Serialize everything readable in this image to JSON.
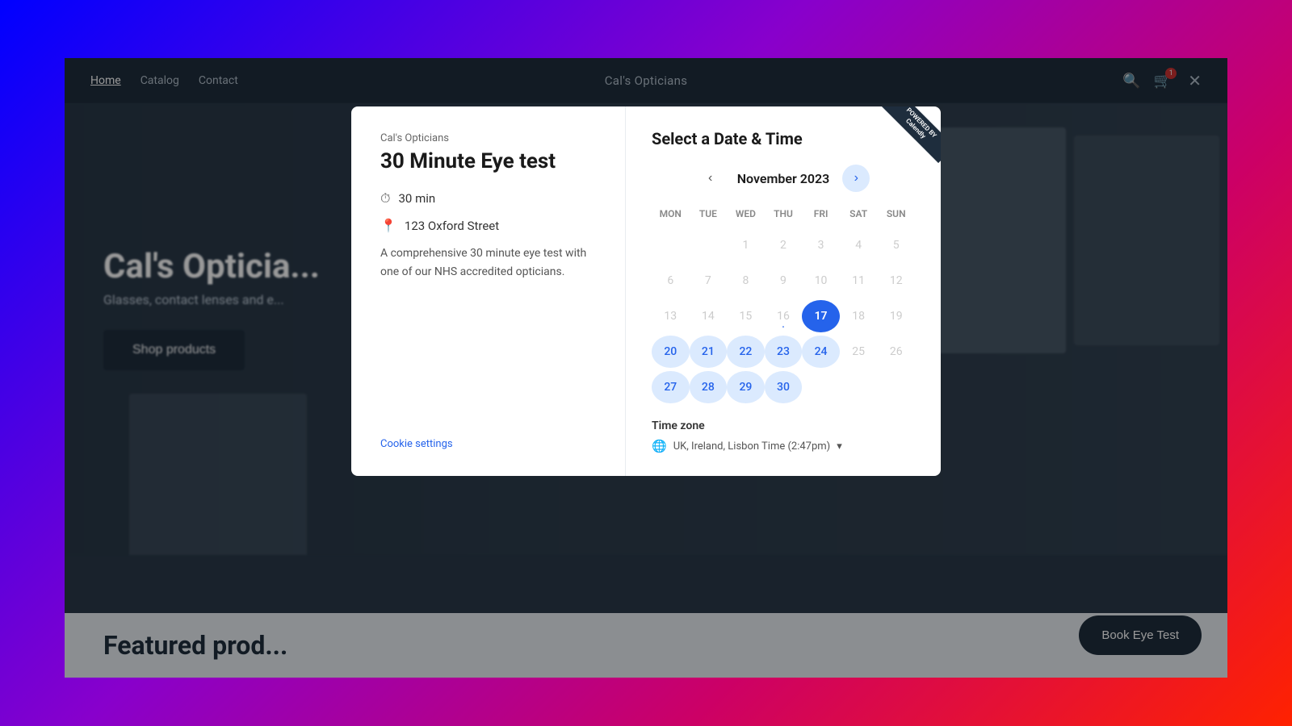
{
  "background": {
    "gradient": "linear-gradient"
  },
  "navbar": {
    "links": [
      {
        "label": "Home",
        "active": true
      },
      {
        "label": "Catalog",
        "active": false
      },
      {
        "label": "Contact",
        "active": false
      }
    ],
    "site_title": "Cal's Opticians",
    "search_icon": "🔍",
    "cart_icon": "🛒",
    "cart_count": "1",
    "close_icon": "✕"
  },
  "hero": {
    "title": "Cal's Opticia...",
    "subtitle": "Glasses, contact lenses and e...",
    "shop_button": "Shop products",
    "featured_label": "Featured prod..."
  },
  "book_button": {
    "label": "Book Eye Test"
  },
  "modal": {
    "left": {
      "company": "Cal's Opticians",
      "service_title": "30 Minute Eye test",
      "duration": "30 min",
      "location": "123 Oxford Street",
      "description": "A comprehensive 30 minute eye test with one of our NHS accredited opticians.",
      "cookie_settings": "Cookie settings"
    },
    "right": {
      "title": "Select a Date & Time",
      "month": "November 2023",
      "prev_btn": "‹",
      "next_btn": "›",
      "day_headers": [
        "MON",
        "TUE",
        "WED",
        "THU",
        "FRI",
        "SAT",
        "SUN"
      ],
      "weeks": [
        [
          {
            "day": "",
            "state": "empty"
          },
          {
            "day": "",
            "state": "empty"
          },
          {
            "day": "1",
            "state": "disabled"
          },
          {
            "day": "2",
            "state": "disabled"
          },
          {
            "day": "3",
            "state": "disabled"
          },
          {
            "day": "4",
            "state": "disabled"
          },
          {
            "day": "5",
            "state": "disabled"
          }
        ],
        [
          {
            "day": "6",
            "state": "disabled"
          },
          {
            "day": "7",
            "state": "disabled"
          },
          {
            "day": "8",
            "state": "disabled"
          },
          {
            "day": "9",
            "state": "disabled"
          },
          {
            "day": "10",
            "state": "disabled"
          },
          {
            "day": "11",
            "state": "disabled"
          },
          {
            "day": "12",
            "state": "disabled"
          }
        ],
        [
          {
            "day": "13",
            "state": "disabled"
          },
          {
            "day": "14",
            "state": "disabled"
          },
          {
            "day": "15",
            "state": "disabled"
          },
          {
            "day": "16",
            "state": "today"
          },
          {
            "day": "17",
            "state": "selected"
          },
          {
            "day": "18",
            "state": "disabled"
          },
          {
            "day": "19",
            "state": "disabled"
          }
        ],
        [
          {
            "day": "20",
            "state": "available"
          },
          {
            "day": "21",
            "state": "available"
          },
          {
            "day": "22",
            "state": "available"
          },
          {
            "day": "23",
            "state": "available"
          },
          {
            "day": "24",
            "state": "available"
          },
          {
            "day": "25",
            "state": "disabled"
          },
          {
            "day": "26",
            "state": "disabled"
          }
        ],
        [
          {
            "day": "27",
            "state": "available"
          },
          {
            "day": "28",
            "state": "available"
          },
          {
            "day": "29",
            "state": "available"
          },
          {
            "day": "30",
            "state": "available"
          },
          {
            "day": "",
            "state": "empty"
          },
          {
            "day": "",
            "state": "empty"
          },
          {
            "day": "",
            "state": "empty"
          }
        ]
      ],
      "timezone_label": "Time zone",
      "timezone_value": "UK, Ireland, Lisbon Time (2:47pm)",
      "calendly_line1": "POWERED BY",
      "calendly_line2": "Calendly"
    }
  }
}
